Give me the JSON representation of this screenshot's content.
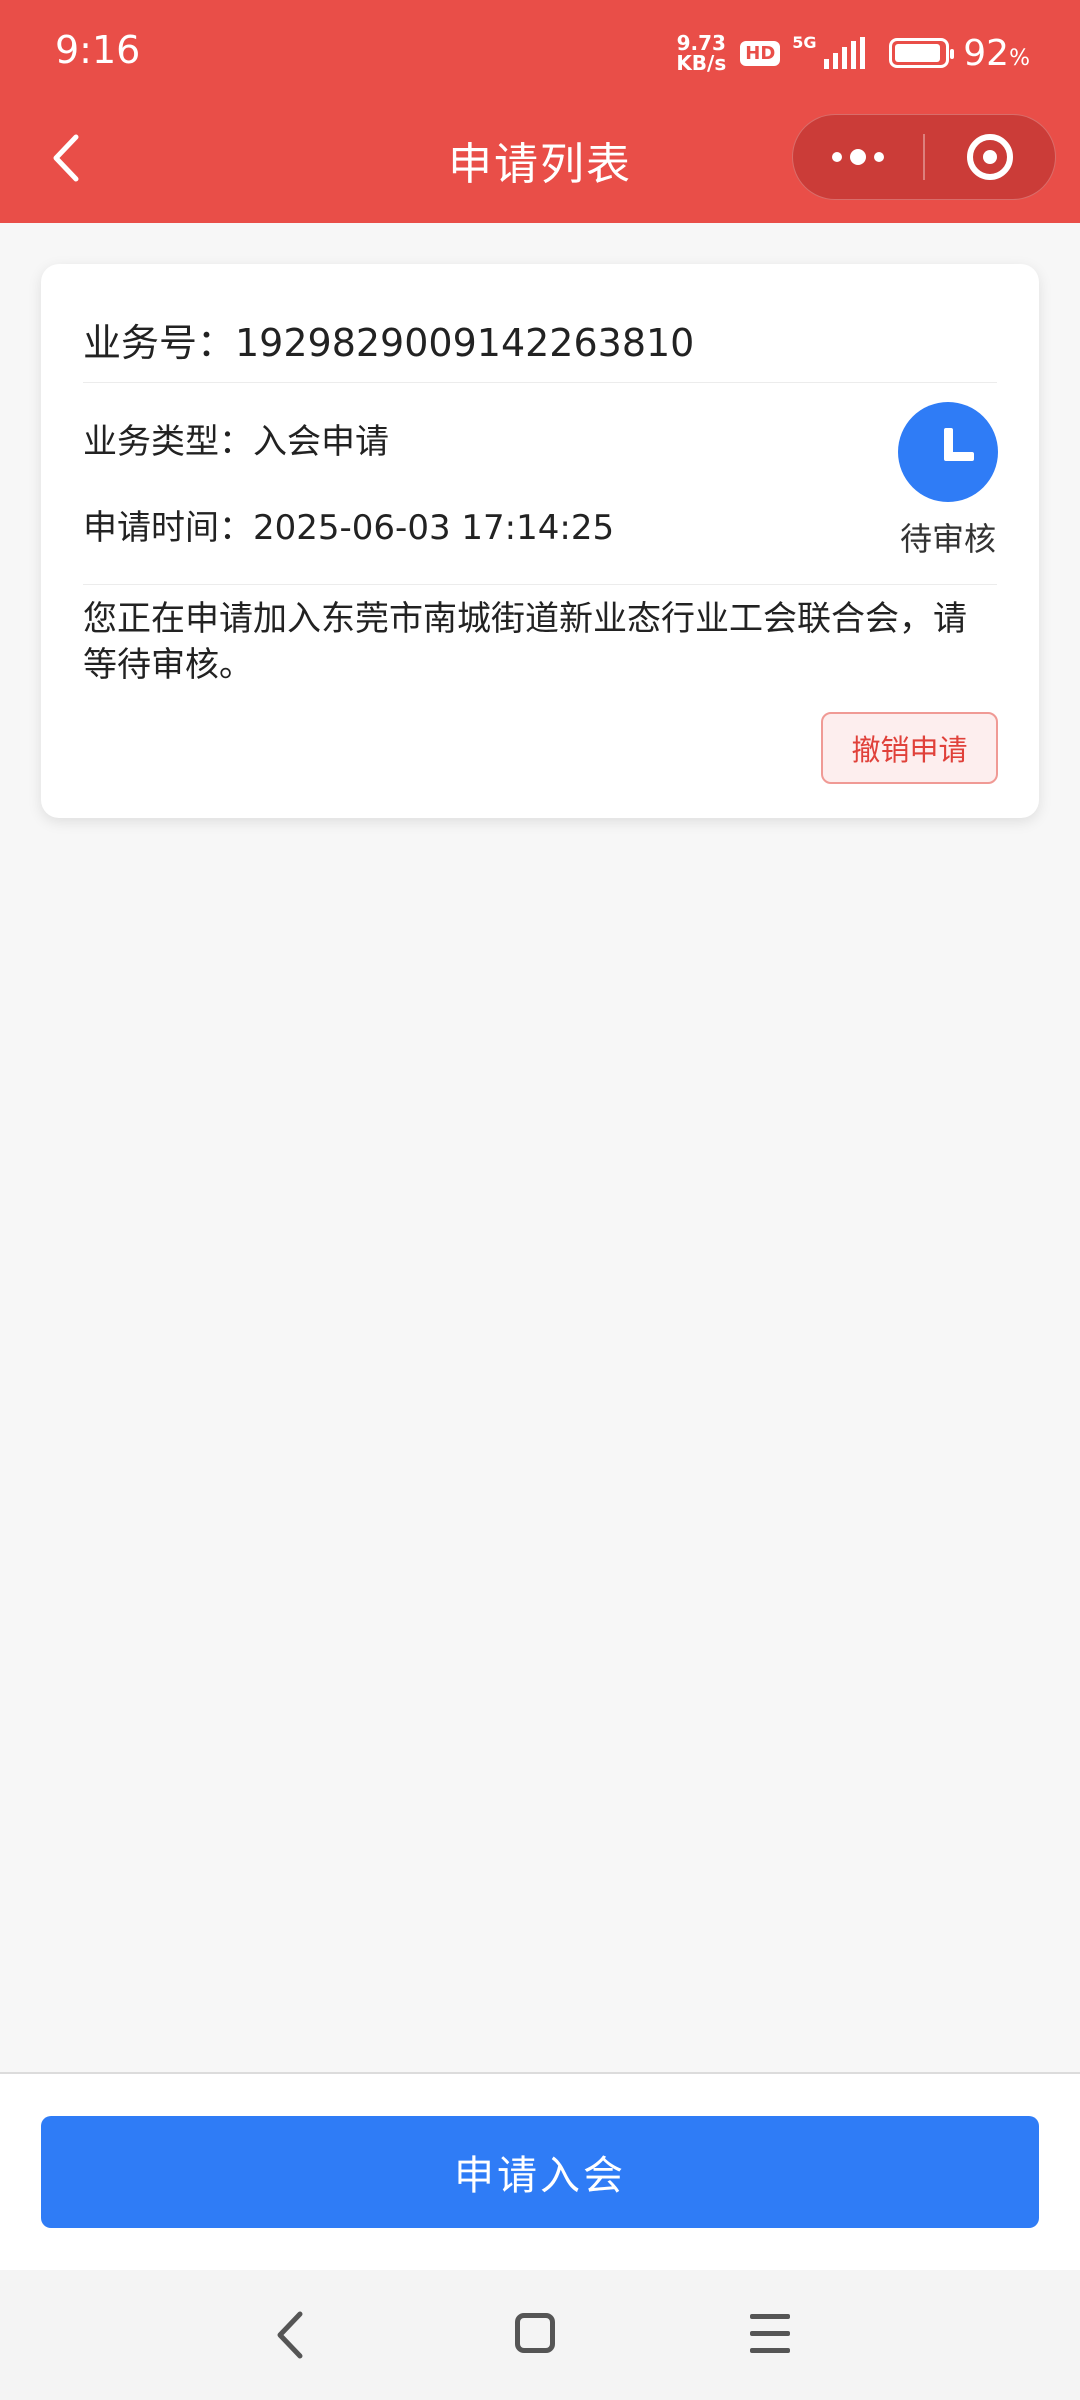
{
  "status_bar": {
    "time": "9:16",
    "net_speed_value": "9.73",
    "net_speed_unit": "KB/s",
    "hd_label": "HD",
    "network_label": "5G",
    "battery_percent": "92",
    "battery_percent_sign": "%"
  },
  "header": {
    "title": "申请列表",
    "back_icon": "chevron-left-icon",
    "more_icon": "more-dots-icon",
    "close_icon": "target-circle-icon"
  },
  "application": {
    "id_text": "业务号：1929829009142263810",
    "type_text": "业务类型：入会申请",
    "time_text": "申请时间：2025-06-03 17:14:25",
    "status_label": "待审核",
    "status_icon": "clock-icon",
    "status_color": "#2f7cf6",
    "notice": "您正在申请加入东莞市南城街道新业态行业工会联合会，请等待审核。",
    "cancel_label": "撤销申请"
  },
  "footer": {
    "apply_label": "申请入会",
    "apply_color": "#2f7cf6"
  },
  "theme": {
    "header_color": "#e94e48",
    "cancel_text_color": "#e0413a"
  }
}
